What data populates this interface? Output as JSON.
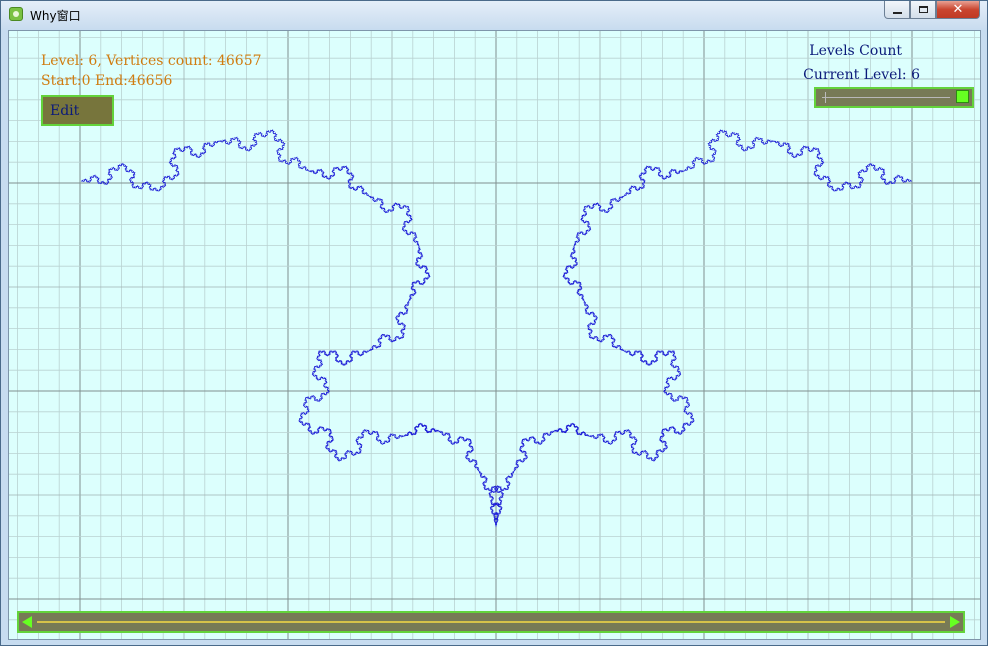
{
  "window": {
    "title": "Why窗口",
    "icon": "app-icon",
    "controls": [
      "minimize-icon",
      "maximize-icon",
      "close-icon"
    ]
  },
  "info": {
    "level_line": "Level: 6, Vertices count: 46657",
    "range_line": "Start:0 End:46656",
    "edit_label": "Edit"
  },
  "levels_panel": {
    "count_label": "Levels Count",
    "current_label": "Current Level: 6",
    "slider_fraction": 1.0
  },
  "scrollbar": {
    "left_arrow": "scroll-left-icon",
    "right_arrow": "scroll-right-icon"
  },
  "colors": {
    "background": "#dcfffd",
    "curve": "#1a1ad6",
    "info_text": "#d07c10",
    "label_text": "#0b1a7a",
    "accent": "#63d33b"
  }
}
